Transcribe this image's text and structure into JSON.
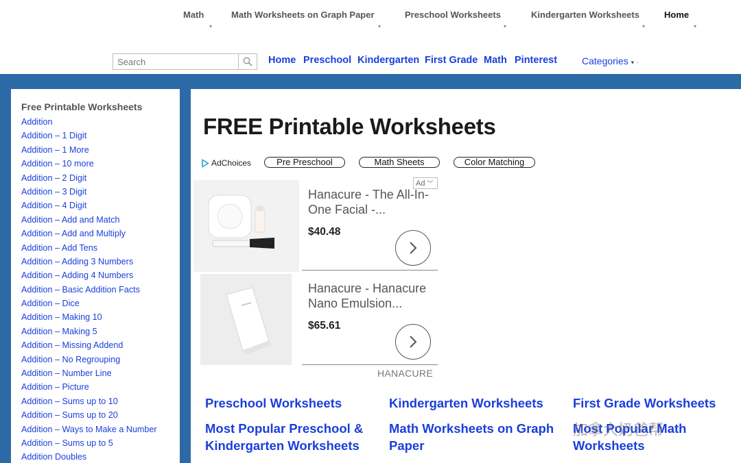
{
  "topnav": {
    "items": [
      {
        "label": "Math"
      },
      {
        "label": "Math Worksheets on Graph Paper"
      },
      {
        "label": "Preschool Worksheets"
      },
      {
        "label": "Kindergarten Worksheets"
      },
      {
        "label": "Home"
      }
    ]
  },
  "search": {
    "placeholder": "Search"
  },
  "quicklinks": [
    "Home",
    "Preschool",
    "Kindergarten",
    "First Grade",
    "Math",
    "Pinterest"
  ],
  "categories_label": "Categories",
  "sidebar": {
    "title": "Free Printable Worksheets",
    "items": [
      "Addition",
      "Addition – 1 Digit",
      "Addition – 1 More",
      "Addition – 10 more",
      "Addition – 2 Digit",
      "Addition – 3 Digit",
      "Addition – 4 Digit",
      "Addition – Add and Match",
      "Addition – Add and Multiply",
      "Addition – Add Tens",
      "Addition – Adding 3 Numbers",
      "Addition – Adding 4 Numbers",
      "Addition – Basic Addition Facts",
      "Addition – Dice",
      "Addition – Making 10",
      "Addition – Making 5",
      "Addition – Missing Addend",
      "Addition – No Regrouping",
      "Addition – Number Line",
      "Addition – Picture",
      "Addition – Sums up to 10",
      "Addition – Sums up to 20",
      "Addition – Ways to Make a Number",
      "Addition – Sums up to 5",
      "Addition Doubles"
    ]
  },
  "main": {
    "heading": "FREE Printable Worksheets",
    "adchoices": "AdChoices",
    "pills": [
      "Pre Preschool",
      "Math Sheets",
      "Color Matching"
    ],
    "ad_badge": "Ad",
    "products": [
      {
        "title": "Hanacure - The All-In-One Facial -...",
        "price": "$40.48"
      },
      {
        "title": "Hanacure - Hanacure Nano Emulsion...",
        "price": "$65.61"
      }
    ],
    "brand": "HANACURE",
    "category_links": [
      "Preschool Worksheets",
      "Kindergarten Worksheets",
      "First Grade Worksheets",
      "Most Popular Preschool & Kindergarten Worksheets",
      "Math Worksheets on Graph Paper",
      "Most Popular Math Worksheets"
    ]
  },
  "watermark": "加拿大奶爸帮",
  "colors": {
    "link": "#1a3edb",
    "band": "#2b6aa6"
  }
}
